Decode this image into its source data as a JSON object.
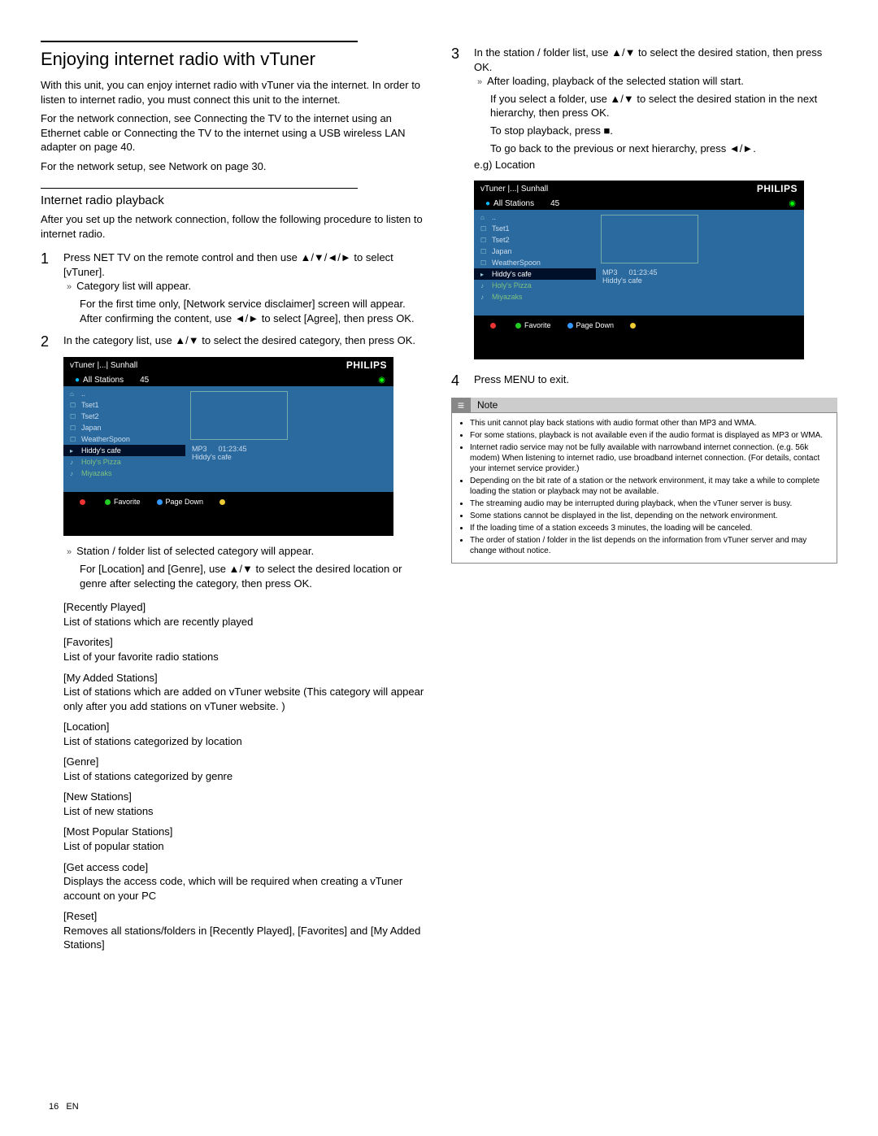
{
  "left": {
    "title": "Enjoying internet radio with vTuner",
    "intro1": "With this unit, you can enjoy internet radio with vTuner via the internet. In order to listen to internet radio, you must connect this unit to the internet.",
    "intro2": "For the network connection, see Connecting the TV to the internet using an Ethernet cable or Connecting the TV to the internet using a USB wireless LAN adapter on page 40.",
    "intro3": "For the network setup, see Network on page 30.",
    "subhead": "Internet radio playback",
    "subintro": "After you set up the network connection, follow the following procedure to listen to internet radio.",
    "step1": "Press NET TV on the remote control and then use ▲/▼/◄/► to select [vTuner].",
    "step1a": "Category list will appear.",
    "step1b": "For the first time only, [Network service disclaimer] screen will appear. After confirming the content, use ◄/► to select [Agree], then press OK.",
    "step2": "In the category list, use ▲/▼ to select the desired category, then press OK.",
    "afterTv1": "Station / folder list of selected category will appear.",
    "afterTv2": "For [Location] and [Genre], use ▲/▼ to select the desired location or genre after selecting the category, then press OK.",
    "cats": [
      {
        "t": "[Recently Played]",
        "d": "List of stations which are recently played"
      },
      {
        "t": "[Favorites]",
        "d": "List of your favorite radio stations"
      },
      {
        "t": "[My Added Stations]",
        "d": "List of stations which are added on vTuner website (This category will appear only after you add stations on vTuner website. )"
      },
      {
        "t": "[Location]",
        "d": "List of stations categorized by location"
      },
      {
        "t": "[Genre]",
        "d": "List of stations categorized by genre"
      },
      {
        "t": "[New Stations]",
        "d": "List of new stations"
      },
      {
        "t": "[Most Popular Stations]",
        "d": "List of popular station"
      },
      {
        "t": "[Get access code]",
        "d": "Displays the access code, which will be required when creating a vTuner account on your PC"
      },
      {
        "t": "[Reset]",
        "d": "Removes all stations/folders in [Recently Played], [Favorites] and [My Added Stations]"
      }
    ]
  },
  "right": {
    "step3": "In the station / folder list, use ▲/▼ to select the desired station, then press OK.",
    "step3a": "After loading, playback of the selected station will start.",
    "step3b": "If you select a folder, use ▲/▼ to select the desired station in the next hierarchy, then press OK.",
    "step3c": "To stop playback, press ■.",
    "step3d": "To go back to the previous or next hierarchy, press ◄/►.",
    "eg": "e.g) Location",
    "step4": "Press MENU to exit.",
    "noteLabel": "Note",
    "notes": [
      "This unit cannot play back stations with audio format other than MP3 and WMA.",
      "For some stations, playback is not available even if the audio format is displayed as MP3 or WMA.",
      "Internet radio service may not be fully available with narrowband internet connection. (e.g. 56k modem) When listening to internet radio, use broadband internet connection. (For details, contact your internet service provider.)",
      "Depending on the bit rate of a station or the network environment, it may take a while to complete loading the station or playback may not be available.",
      "The streaming audio may be interrupted during playback, when the vTuner server is busy.",
      "Some stations cannot be displayed in the list, depending on the network environment.",
      "If the loading time of a station exceeds 3 minutes, the loading will be canceled.",
      "The order of station / folder in the list depends on the information from vTuner server and may change without notice."
    ]
  },
  "tv": {
    "brand": "PHILIPS",
    "breadcrumb": "vTuner |...| Sunhall",
    "all": "All Stations",
    "count": "45",
    "items": [
      {
        "icon": "⌂",
        "label": ".."
      },
      {
        "icon": "☐",
        "label": "Tset1"
      },
      {
        "icon": "☐",
        "label": "Tset2"
      },
      {
        "icon": "☐",
        "label": "Japan"
      },
      {
        "icon": "☐",
        "label": "WeatherSpoon"
      },
      {
        "icon": "▸",
        "label": "Hiddy's cafe",
        "sel": true
      },
      {
        "icon": "♪",
        "label": "Holy's Pizza",
        "fav": true
      },
      {
        "icon": "♪",
        "label": "Miyazaks",
        "fav": true
      }
    ],
    "mp3": "MP3",
    "time": "01:23:45",
    "nowplaying": "Hiddy's cafe",
    "favorite": "Favorite",
    "pagedown": "Page Down"
  },
  "footer": {
    "page": "16",
    "lang": "EN"
  }
}
